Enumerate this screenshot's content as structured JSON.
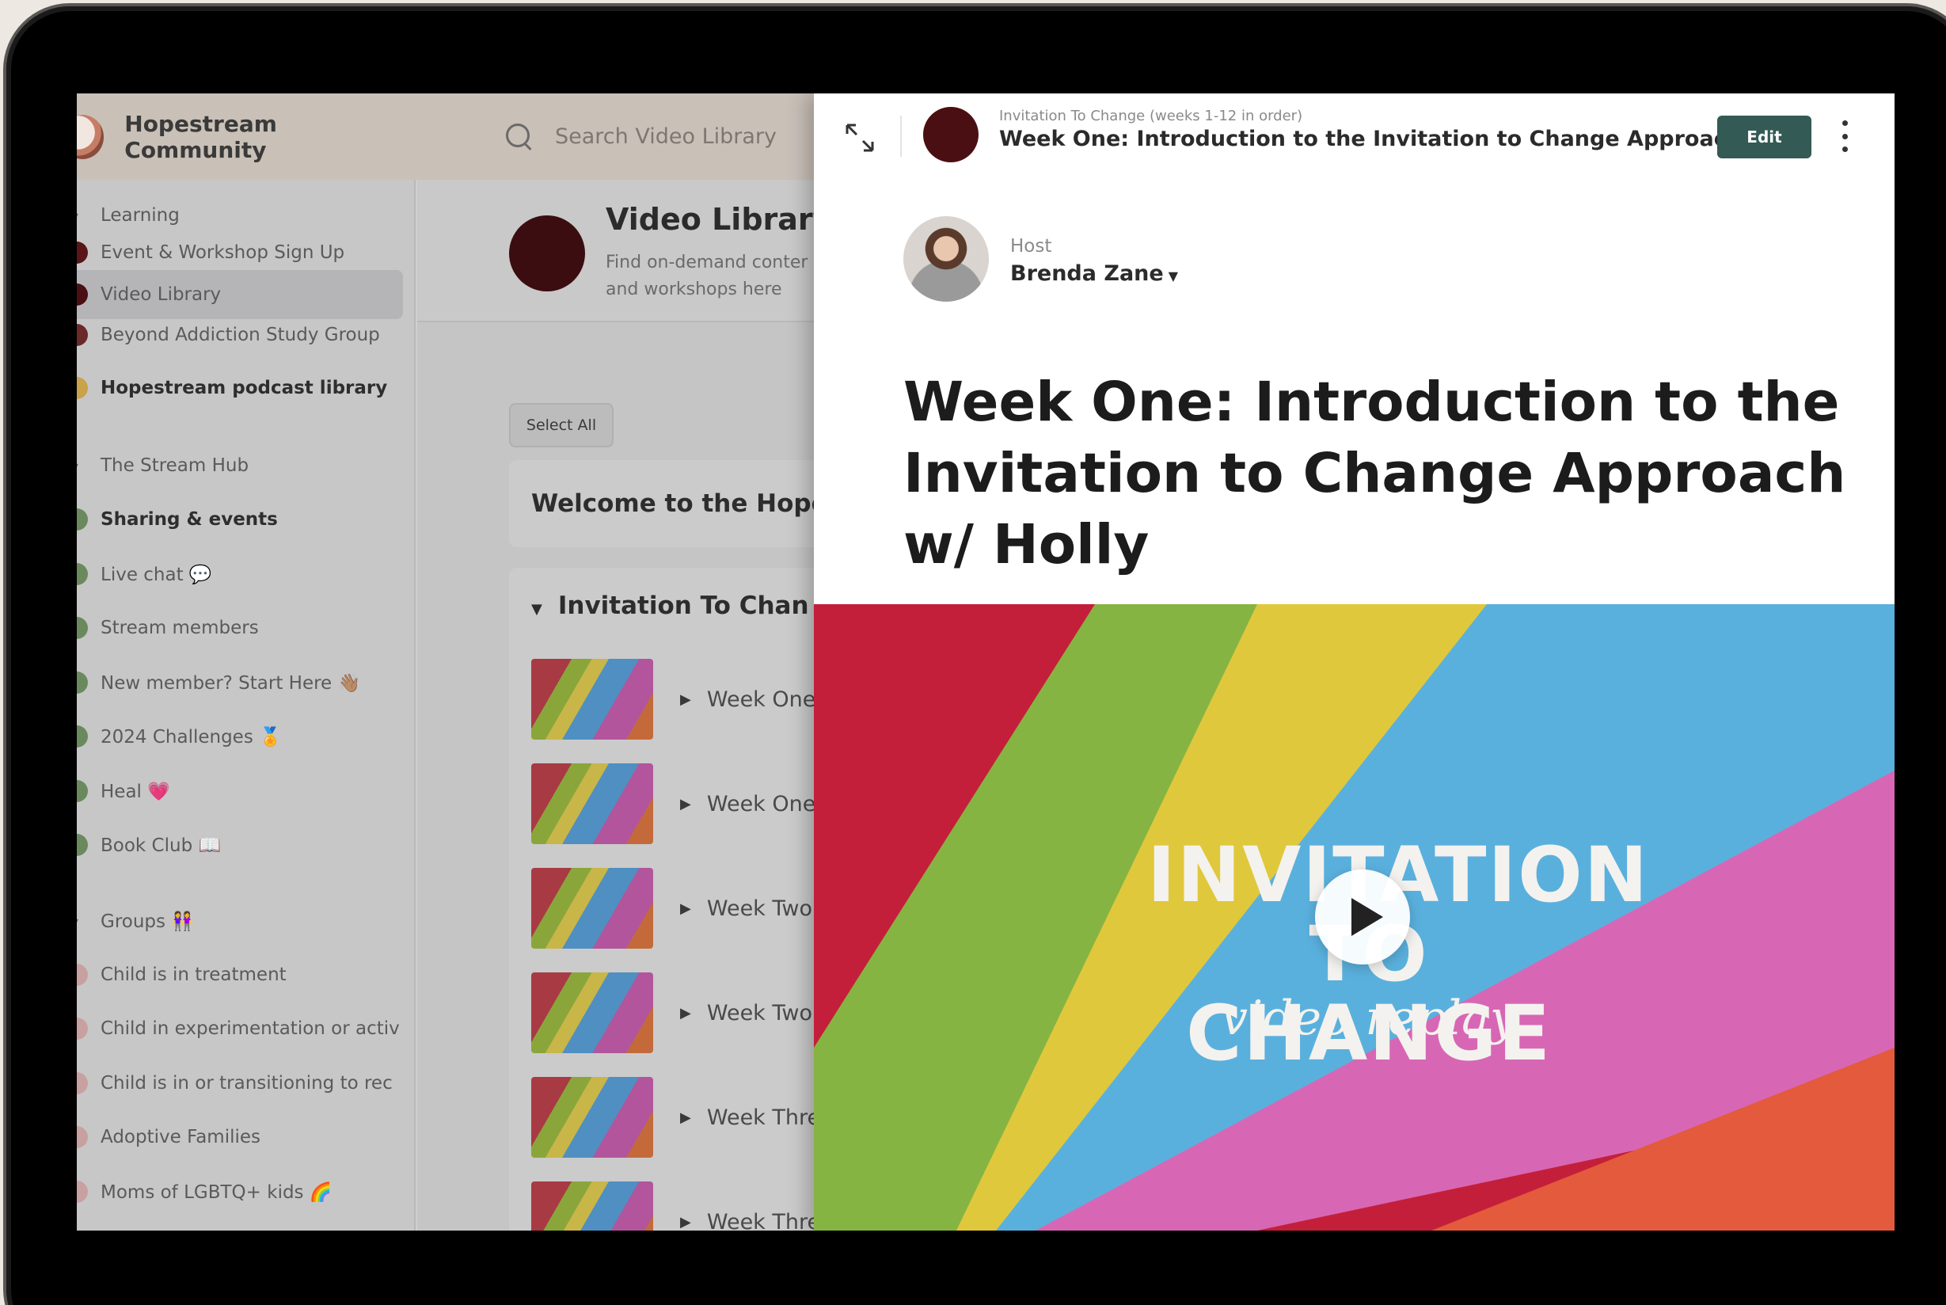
{
  "app": {
    "community_name": "Hopestream Community",
    "search_placeholder": "Search Video Library"
  },
  "sidebar": {
    "items": [
      {
        "label": "Learning"
      },
      {
        "label": "Event & Workshop Sign Up"
      },
      {
        "label": "Video Library"
      },
      {
        "label": "Beyond Addiction Study Group"
      },
      {
        "label": "Hopestream podcast library"
      },
      {
        "label": "The Stream Hub"
      },
      {
        "label": "Sharing & events"
      },
      {
        "label": "Live chat 💬"
      },
      {
        "label": "Stream members"
      },
      {
        "label": "New member? Start Here 👋🏽"
      },
      {
        "label": "2024 Challenges 🏅"
      },
      {
        "label": "Heal 💗"
      },
      {
        "label": "Book Club 📖"
      },
      {
        "label": "Groups 👭"
      },
      {
        "label": "Child is in treatment"
      },
      {
        "label": "Child in experimentation or activ"
      },
      {
        "label": "Child is in or transitioning to rec"
      },
      {
        "label": "Adoptive Families"
      },
      {
        "label": "Moms of LGBTQ+ kids 🌈"
      }
    ]
  },
  "library": {
    "title": "Video Library",
    "desc_line1": "Find on-demand conter",
    "desc_line2": "and workshops here",
    "select_all": "Select All",
    "welcome": "Welcome to the Hope",
    "section": "Invitation To Chan",
    "videos": [
      {
        "label": "Week One"
      },
      {
        "label": "Week One"
      },
      {
        "label": "Week Two"
      },
      {
        "label": "Week Two"
      },
      {
        "label": "Week Thre"
      },
      {
        "label": "Week Thre"
      }
    ]
  },
  "panel": {
    "breadcrumb": "Invitation To Change (weeks 1-12 in order)",
    "header_title": "Week One: Introduction to the Invitation to Change Approach w/ ...",
    "edit_label": "Edit",
    "host_label": "Host",
    "host_name": "Brenda Zane",
    "post_title": "Week One: Introduction to the Invitation to Change Approach w/ Holly",
    "video_title_line1": "INVITATION",
    "video_title_line2": "TO CHANGE",
    "video_subtitle": "video replay"
  }
}
